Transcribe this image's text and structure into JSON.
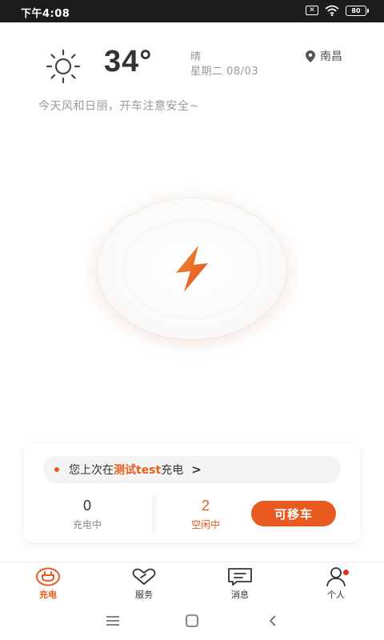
{
  "status_bar": {
    "time": "下午4:08",
    "battery": "80"
  },
  "weather": {
    "temperature": "34°",
    "condition": "晴",
    "date": "星期二 08/03",
    "city": "南昌",
    "tip": "今天风和日丽，开车注意安全~"
  },
  "card": {
    "last_charge_prefix": "您上次在",
    "station_name": "测试test",
    "last_charge_suffix": "充电",
    "chevron": ">",
    "charging_count": "0",
    "charging_label": "充电中",
    "idle_count": "2",
    "idle_label": "空闲中",
    "move_car_label": "可移车"
  },
  "tabs": [
    {
      "label": "充电",
      "icon": "plug-icon",
      "active": true
    },
    {
      "label": "服务",
      "icon": "heart-tag-icon",
      "active": false
    },
    {
      "label": "消息",
      "icon": "message-icon",
      "active": false
    },
    {
      "label": "个人",
      "icon": "person-icon",
      "active": false
    }
  ],
  "colors": {
    "accent": "#e85a20",
    "text": "#333333",
    "muted": "#999999"
  }
}
